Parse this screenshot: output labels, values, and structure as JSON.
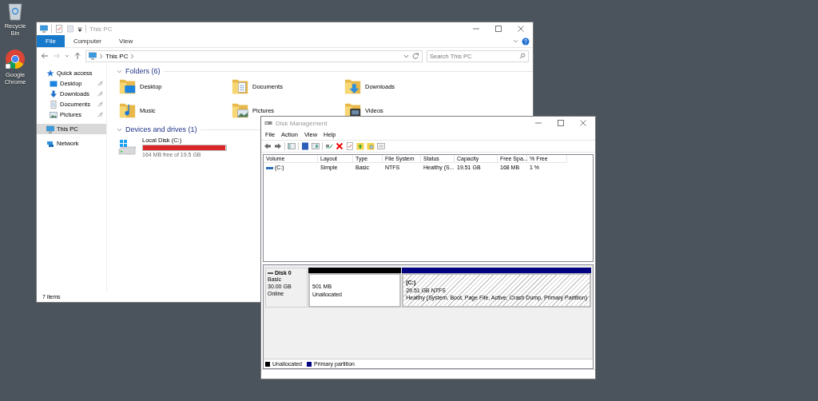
{
  "desktop_icons": [
    {
      "label": "Recycle Bin",
      "kind": "recycle"
    },
    {
      "label": "Google Chrome",
      "kind": "browser"
    }
  ],
  "explorer": {
    "title": "This PC",
    "ribbon_tabs": [
      {
        "label": "File",
        "selected": true
      },
      {
        "label": "Computer",
        "selected": false
      },
      {
        "label": "View",
        "selected": false
      }
    ],
    "address": "This PC",
    "search": {
      "placeholder": "Search This PC"
    },
    "sidebar": [
      {
        "label": "Quick access",
        "kind": "star",
        "selected": false,
        "children": [
          {
            "label": "Desktop",
            "kind": "desktop",
            "selected": false,
            "pinned": true
          },
          {
            "label": "Downloads",
            "kind": "downloads",
            "selected": false,
            "pinned": true
          },
          {
            "label": "Documents",
            "kind": "documents",
            "selected": false,
            "pinned": true
          },
          {
            "label": "Pictures",
            "kind": "pictures",
            "selected": false,
            "pinned": true
          }
        ]
      },
      {
        "label": "This PC",
        "kind": "computer",
        "selected": true
      },
      {
        "label": "Network",
        "kind": "network",
        "selected": false
      }
    ],
    "folders_header": "Folders (6)",
    "folders": [
      {
        "label": "Desktop",
        "kind": "desktop"
      },
      {
        "label": "Documents",
        "kind": "documents"
      },
      {
        "label": "Downloads",
        "kind": "downloads"
      },
      {
        "label": "Music",
        "kind": "music"
      },
      {
        "label": "Pictures",
        "kind": "pictures"
      },
      {
        "label": "Videos",
        "kind": "videos"
      }
    ],
    "drives_header": "Devices and drives (1)",
    "drives": [
      {
        "label": "Local Disk (C:)",
        "level": 0.99,
        "detail": "164 MB free of 19.5 GB"
      }
    ],
    "status_bar": "7 items"
  },
  "disk_management": {
    "title": "Disk Management",
    "menu": [
      "File",
      "Action",
      "View",
      "Help"
    ],
    "columns": [
      "Volume",
      "Layout",
      "Type",
      "File System",
      "Status",
      "Capacity",
      "Free Spa...",
      "% Free"
    ],
    "rows": [
      {
        "cells": [
          "(C:)",
          "Simple",
          "Basic",
          "NTFS",
          "Healthy (S...",
          "19.51 GB",
          "168 MB",
          "1 %"
        ]
      }
    ],
    "disks": [
      {
        "name": "Disk 0",
        "type": "Basic",
        "size": "30.00 GB",
        "status": "Online",
        "partitions": [
          {
            "kind": "unallocated",
            "size": "501 MB",
            "status": "Unallocated"
          },
          {
            "kind": "primary",
            "name": "(C:)",
            "size": "29.51 GB NTFS",
            "status": "Healthy (System, Boot, Page File, Active, Crash Dump, Primary Partition)"
          }
        ]
      }
    ],
    "legend": [
      {
        "label": "Unallocated",
        "color": "#000000"
      },
      {
        "label": "Primary partition",
        "color": "#000080"
      }
    ]
  }
}
